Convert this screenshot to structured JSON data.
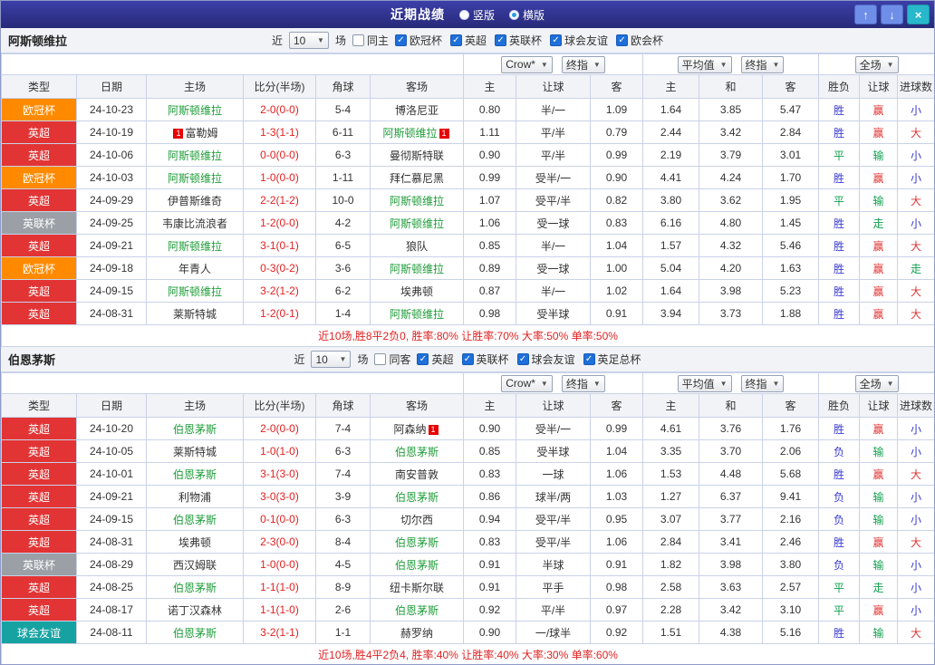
{
  "titlebar": {
    "title": "近期战绩",
    "layout_options": [
      {
        "label": "竖版",
        "selected": false
      },
      {
        "label": "横版",
        "selected": true
      }
    ],
    "up_button": "↑",
    "down_button": "↓",
    "close_button": "×"
  },
  "icons": {
    "dropdown_arrow": "▼",
    "check": "✓"
  },
  "filter_labels": {
    "prefix": "近",
    "suffix": "场"
  },
  "dropdowns": {
    "source": "Crow*",
    "final": "终指",
    "average": "平均值",
    "final2": "终指",
    "scope": "全场"
  },
  "columns": {
    "type": "类型",
    "date": "日期",
    "home": "主场",
    "score": "比分(半场)",
    "corners": "角球",
    "away": "客场",
    "odds_home": "主",
    "odds_handicap": "让球",
    "odds_away": "客",
    "avg_home": "主",
    "avg_draw": "和",
    "avg_away": "客",
    "result": "胜负",
    "handicap_result": "让球",
    "goals_result": "进球数"
  },
  "colors": {
    "type_bg": {
      "欧冠杯": "#ff8a00",
      "英超": "#e23434",
      "英联杯": "#9aa0a6",
      "球会友谊": "#17a2a2"
    },
    "focus_team": "#1f9d3a",
    "opponent_team": "#333333",
    "score": "#e02222",
    "result": {
      "胜": "#3a3ad0",
      "平": "#12a04f",
      "负": "#3a3ad0"
    },
    "handicap": {
      "赢": "#e23434",
      "输": "#12a04f",
      "走": "#12a04f"
    },
    "goals": {
      "大": "#e23434",
      "小": "#3a3ad0",
      "走": "#12a04f"
    }
  },
  "sections": [
    {
      "team": "阿斯顿维拉",
      "filter": {
        "count": "10",
        "same_label": "同主",
        "same_checked": false,
        "competitions": [
          {
            "label": "欧冠杯",
            "checked": true
          },
          {
            "label": "英超",
            "checked": true
          },
          {
            "label": "英联杯",
            "checked": true
          },
          {
            "label": "球会友谊",
            "checked": true
          },
          {
            "label": "欧会杯",
            "checked": true
          }
        ]
      },
      "rows": [
        {
          "type": "欧冠杯",
          "date": "24-10-23",
          "home": "阿斯顿维拉",
          "home_focus": true,
          "home_card": "",
          "score": "2-0(0-0)",
          "corners": "5-4",
          "away": "博洛尼亚",
          "away_focus": false,
          "away_card": "",
          "odds": [
            "0.80",
            "半/一",
            "1.09"
          ],
          "avg": [
            "1.64",
            "3.85",
            "5.47"
          ],
          "result": "胜",
          "handicap": "赢",
          "goals": "小"
        },
        {
          "type": "英超",
          "date": "24-10-19",
          "home": "富勒姆",
          "home_focus": false,
          "home_card": "1",
          "score": "1-3(1-1)",
          "corners": "6-11",
          "away": "阿斯顿维拉",
          "away_focus": true,
          "away_card": "1",
          "odds": [
            "1.11",
            "平/半",
            "0.79"
          ],
          "avg": [
            "2.44",
            "3.42",
            "2.84"
          ],
          "result": "胜",
          "handicap": "赢",
          "goals": "大"
        },
        {
          "type": "英超",
          "date": "24-10-06",
          "home": "阿斯顿维拉",
          "home_focus": true,
          "home_card": "",
          "score": "0-0(0-0)",
          "corners": "6-3",
          "away": "曼彻斯特联",
          "away_focus": false,
          "away_card": "",
          "odds": [
            "0.90",
            "平/半",
            "0.99"
          ],
          "avg": [
            "2.19",
            "3.79",
            "3.01"
          ],
          "result": "平",
          "handicap": "输",
          "goals": "小"
        },
        {
          "type": "欧冠杯",
          "date": "24-10-03",
          "home": "阿斯顿维拉",
          "home_focus": true,
          "home_card": "",
          "score": "1-0(0-0)",
          "corners": "1-11",
          "away": "拜仁慕尼黑",
          "away_focus": false,
          "away_card": "",
          "odds": [
            "0.99",
            "受半/一",
            "0.90"
          ],
          "avg": [
            "4.41",
            "4.24",
            "1.70"
          ],
          "result": "胜",
          "handicap": "赢",
          "goals": "小"
        },
        {
          "type": "英超",
          "date": "24-09-29",
          "home": "伊普斯维奇",
          "home_focus": false,
          "home_card": "",
          "score": "2-2(1-2)",
          "corners": "10-0",
          "away": "阿斯顿维拉",
          "away_focus": true,
          "away_card": "",
          "odds": [
            "1.07",
            "受平/半",
            "0.82"
          ],
          "avg": [
            "3.80",
            "3.62",
            "1.95"
          ],
          "result": "平",
          "handicap": "输",
          "goals": "大"
        },
        {
          "type": "英联杯",
          "date": "24-09-25",
          "home": "韦康比流浪者",
          "home_focus": false,
          "home_card": "",
          "score": "1-2(0-0)",
          "corners": "4-2",
          "away": "阿斯顿维拉",
          "away_focus": true,
          "away_card": "",
          "odds": [
            "1.06",
            "受一球",
            "0.83"
          ],
          "avg": [
            "6.16",
            "4.80",
            "1.45"
          ],
          "result": "胜",
          "handicap": "走",
          "goals": "小"
        },
        {
          "type": "英超",
          "date": "24-09-21",
          "home": "阿斯顿维拉",
          "home_focus": true,
          "home_card": "",
          "score": "3-1(0-1)",
          "corners": "6-5",
          "away": "狼队",
          "away_focus": false,
          "away_card": "",
          "odds": [
            "0.85",
            "半/一",
            "1.04"
          ],
          "avg": [
            "1.57",
            "4.32",
            "5.46"
          ],
          "result": "胜",
          "handicap": "赢",
          "goals": "大"
        },
        {
          "type": "欧冠杯",
          "date": "24-09-18",
          "home": "年青人",
          "home_focus": false,
          "home_card": "",
          "score": "0-3(0-2)",
          "corners": "3-6",
          "away": "阿斯顿维拉",
          "away_focus": true,
          "away_card": "",
          "odds": [
            "0.89",
            "受一球",
            "1.00"
          ],
          "avg": [
            "5.04",
            "4.20",
            "1.63"
          ],
          "result": "胜",
          "handicap": "赢",
          "goals": "走"
        },
        {
          "type": "英超",
          "date": "24-09-15",
          "home": "阿斯顿维拉",
          "home_focus": true,
          "home_card": "",
          "score": "3-2(1-2)",
          "corners": "6-2",
          "away": "埃弗顿",
          "away_focus": false,
          "away_card": "",
          "odds": [
            "0.87",
            "半/一",
            "1.02"
          ],
          "avg": [
            "1.64",
            "3.98",
            "5.23"
          ],
          "result": "胜",
          "handicap": "赢",
          "goals": "大"
        },
        {
          "type": "英超",
          "date": "24-08-31",
          "home": "莱斯特城",
          "home_focus": false,
          "home_card": "",
          "score": "1-2(0-1)",
          "corners": "1-4",
          "away": "阿斯顿维拉",
          "away_focus": true,
          "away_card": "",
          "odds": [
            "0.98",
            "受半球",
            "0.91"
          ],
          "avg": [
            "3.94",
            "3.73",
            "1.88"
          ],
          "result": "胜",
          "handicap": "赢",
          "goals": "大"
        }
      ],
      "summary": "近10场,胜8平2负0, 胜率:80% 让胜率:70% 大率:50% 单率:50%"
    },
    {
      "team": "伯恩茅斯",
      "filter": {
        "count": "10",
        "same_label": "同客",
        "same_checked": false,
        "competitions": [
          {
            "label": "英超",
            "checked": true
          },
          {
            "label": "英联杯",
            "checked": true
          },
          {
            "label": "球会友谊",
            "checked": true
          },
          {
            "label": "英足总杯",
            "checked": true
          }
        ]
      },
      "rows": [
        {
          "type": "英超",
          "date": "24-10-20",
          "home": "伯恩茅斯",
          "home_focus": true,
          "home_card": "",
          "score": "2-0(0-0)",
          "corners": "7-4",
          "away": "阿森纳",
          "away_focus": false,
          "away_card": "1",
          "odds": [
            "0.90",
            "受半/一",
            "0.99"
          ],
          "avg": [
            "4.61",
            "3.76",
            "1.76"
          ],
          "result": "胜",
          "handicap": "赢",
          "goals": "小"
        },
        {
          "type": "英超",
          "date": "24-10-05",
          "home": "莱斯特城",
          "home_focus": false,
          "home_card": "",
          "score": "1-0(1-0)",
          "corners": "6-3",
          "away": "伯恩茅斯",
          "away_focus": true,
          "away_card": "",
          "odds": [
            "0.85",
            "受半球",
            "1.04"
          ],
          "avg": [
            "3.35",
            "3.70",
            "2.06"
          ],
          "result": "负",
          "handicap": "输",
          "goals": "小"
        },
        {
          "type": "英超",
          "date": "24-10-01",
          "home": "伯恩茅斯",
          "home_focus": true,
          "home_card": "",
          "score": "3-1(3-0)",
          "corners": "7-4",
          "away": "南安普敦",
          "away_focus": false,
          "away_card": "",
          "odds": [
            "0.83",
            "一球",
            "1.06"
          ],
          "avg": [
            "1.53",
            "4.48",
            "5.68"
          ],
          "result": "胜",
          "handicap": "赢",
          "goals": "大"
        },
        {
          "type": "英超",
          "date": "24-09-21",
          "home": "利物浦",
          "home_focus": false,
          "home_card": "",
          "score": "3-0(3-0)",
          "corners": "3-9",
          "away": "伯恩茅斯",
          "away_focus": true,
          "away_card": "",
          "odds": [
            "0.86",
            "球半/两",
            "1.03"
          ],
          "avg": [
            "1.27",
            "6.37",
            "9.41"
          ],
          "result": "负",
          "handicap": "输",
          "goals": "小"
        },
        {
          "type": "英超",
          "date": "24-09-15",
          "home": "伯恩茅斯",
          "home_focus": true,
          "home_card": "",
          "score": "0-1(0-0)",
          "corners": "6-3",
          "away": "切尔西",
          "away_focus": false,
          "away_card": "",
          "odds": [
            "0.94",
            "受平/半",
            "0.95"
          ],
          "avg": [
            "3.07",
            "3.77",
            "2.16"
          ],
          "result": "负",
          "handicap": "输",
          "goals": "小"
        },
        {
          "type": "英超",
          "date": "24-08-31",
          "home": "埃弗顿",
          "home_focus": false,
          "home_card": "",
          "score": "2-3(0-0)",
          "corners": "8-4",
          "away": "伯恩茅斯",
          "away_focus": true,
          "away_card": "",
          "odds": [
            "0.83",
            "受平/半",
            "1.06"
          ],
          "avg": [
            "2.84",
            "3.41",
            "2.46"
          ],
          "result": "胜",
          "handicap": "赢",
          "goals": "大"
        },
        {
          "type": "英联杯",
          "date": "24-08-29",
          "home": "西汉姆联",
          "home_focus": false,
          "home_card": "",
          "score": "1-0(0-0)",
          "corners": "4-5",
          "away": "伯恩茅斯",
          "away_focus": true,
          "away_card": "",
          "odds": [
            "0.91",
            "半球",
            "0.91"
          ],
          "avg": [
            "1.82",
            "3.98",
            "3.80"
          ],
          "result": "负",
          "handicap": "输",
          "goals": "小"
        },
        {
          "type": "英超",
          "date": "24-08-25",
          "home": "伯恩茅斯",
          "home_focus": true,
          "home_card": "",
          "score": "1-1(1-0)",
          "corners": "8-9",
          "away": "纽卡斯尔联",
          "away_focus": false,
          "away_card": "",
          "odds": [
            "0.91",
            "平手",
            "0.98"
          ],
          "avg": [
            "2.58",
            "3.63",
            "2.57"
          ],
          "result": "平",
          "handicap": "走",
          "goals": "小"
        },
        {
          "type": "英超",
          "date": "24-08-17",
          "home": "诺丁汉森林",
          "home_focus": false,
          "home_card": "",
          "score": "1-1(1-0)",
          "corners": "2-6",
          "away": "伯恩茅斯",
          "away_focus": true,
          "away_card": "",
          "odds": [
            "0.92",
            "平/半",
            "0.97"
          ],
          "avg": [
            "2.28",
            "3.42",
            "3.10"
          ],
          "result": "平",
          "handicap": "赢",
          "goals": "小"
        },
        {
          "type": "球会友谊",
          "date": "24-08-11",
          "home": "伯恩茅斯",
          "home_focus": true,
          "home_card": "",
          "score": "3-2(1-1)",
          "corners": "1-1",
          "away": "赫罗纳",
          "away_focus": false,
          "away_card": "",
          "odds": [
            "0.90",
            "一/球半",
            "0.92"
          ],
          "avg": [
            "1.51",
            "4.38",
            "5.16"
          ],
          "result": "胜",
          "handicap": "输",
          "goals": "大"
        }
      ],
      "summary": "近10场,胜4平2负4, 胜率:40% 让胜率:40% 大率:30% 单率:60%"
    }
  ]
}
